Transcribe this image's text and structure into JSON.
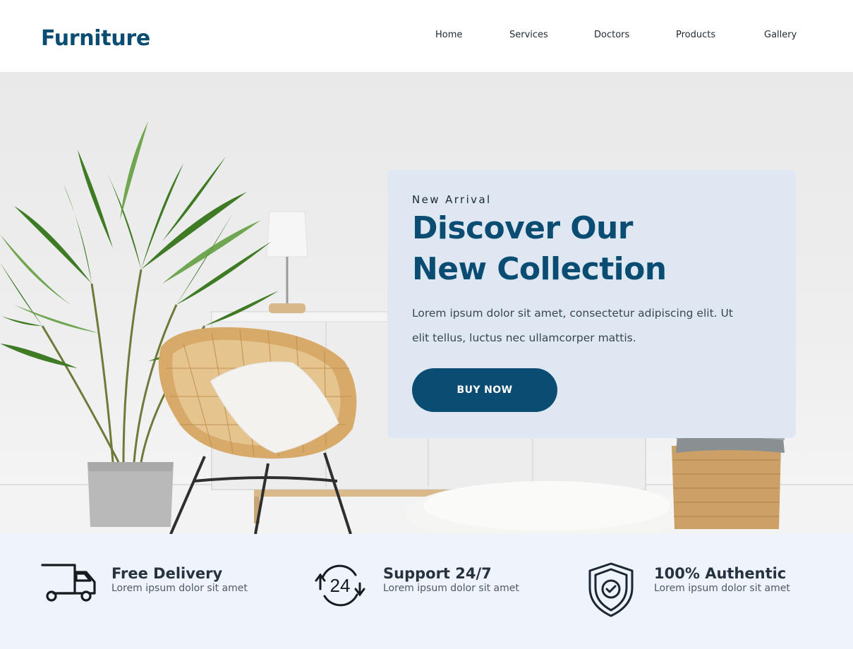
{
  "header": {
    "logo": "Furniture",
    "nav": [
      "Home",
      "Services",
      "Doctors",
      "Products",
      "Gallery"
    ]
  },
  "hero": {
    "eyebrow": "New Arrival",
    "title_line1": "Discover Our",
    "title_line2": "New Collection",
    "description_line1": "Lorem ipsum dolor sit amet, consectetur adipiscing elit. Ut",
    "description_line2": "elit tellus, luctus nec ullamcorper mattis.",
    "cta_label": "BUY NOW"
  },
  "features": [
    {
      "icon": "delivery-truck-icon",
      "title": "Free Delivery",
      "subtitle": "Lorem ipsum dolor sit amet"
    },
    {
      "icon": "support-24-icon",
      "title": "Support 24/7",
      "subtitle": "Lorem ipsum dolor sit amet"
    },
    {
      "icon": "shield-check-icon",
      "title": "100% Authentic",
      "subtitle": "Lorem ipsum dolor sit amet"
    }
  ],
  "colors": {
    "brand": "#0a4c72",
    "card_background": "#dee7f2",
    "features_background": "#eff3fc"
  }
}
